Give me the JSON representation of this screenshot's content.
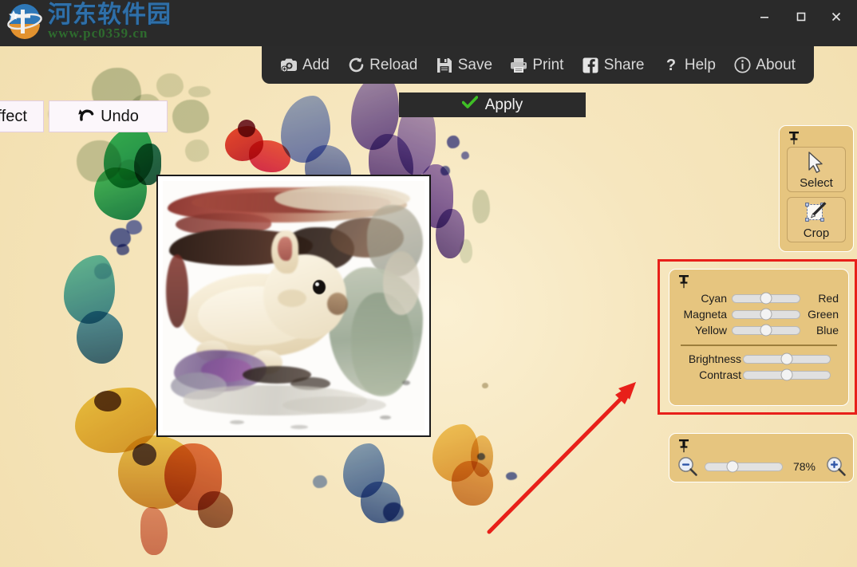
{
  "window": {
    "watermark_cn": "河东软件园",
    "watermark_url": "www.pc0359.cn",
    "controls": {
      "minimize": "minimize-icon",
      "maximize": "maximize-icon",
      "close": "close-icon"
    }
  },
  "toolbar": {
    "items": [
      {
        "label": "Add",
        "icon": "camera-add-icon"
      },
      {
        "label": "Reload",
        "icon": "refresh-icon"
      },
      {
        "label": "Save",
        "icon": "floppy-disk-icon"
      },
      {
        "label": "Print",
        "icon": "printer-icon"
      },
      {
        "label": "Share",
        "icon": "facebook-icon"
      },
      {
        "label": "Help",
        "icon": "question-mark-icon"
      },
      {
        "label": "About",
        "icon": "info-circle-icon"
      }
    ]
  },
  "actions": {
    "effect_label": "Effect",
    "undo_label": "Undo",
    "undo_icon": "undo-arrow-icon",
    "apply_label": "Apply",
    "apply_icon": "green-check-icon"
  },
  "tools_panel": {
    "pin_icon": "pushpin-icon",
    "buttons": [
      {
        "label": "Select",
        "icon": "cursor-arrow-icon"
      },
      {
        "label": "Crop",
        "icon": "crop-pen-icon"
      }
    ]
  },
  "color_panel": {
    "pin_icon": "pushpin-icon",
    "highlight_color": "#E8201A",
    "sliders": [
      {
        "left_label": "Cyan",
        "right_label": "Red",
        "value": 50
      },
      {
        "left_label": "Magneta",
        "right_label": "Green",
        "value": 50
      },
      {
        "left_label": "Yellow",
        "right_label": "Blue",
        "value": 50
      }
    ],
    "adjust_sliders": [
      {
        "left_label": "Brightness",
        "right_label": "",
        "value": 50
      },
      {
        "left_label": "Contrast",
        "right_label": "",
        "value": 50
      }
    ]
  },
  "zoom_panel": {
    "pin_icon": "pushpin-icon",
    "zoom_out_icon": "magnifier-minus-icon",
    "zoom_in_icon": "magnifier-plus-icon",
    "percent_label": "78%",
    "slider_value": 35
  },
  "canvas": {
    "image_alt": "watercolor-rabbit-photo"
  },
  "annotation": {
    "arrow_color": "#E8201A",
    "arrow_icon": "annotation-arrow-icon"
  },
  "theme": {
    "panel_bg": "#E6C57F",
    "toolbar_bg": "#2B2B2B",
    "background": "#F6E7C1"
  }
}
